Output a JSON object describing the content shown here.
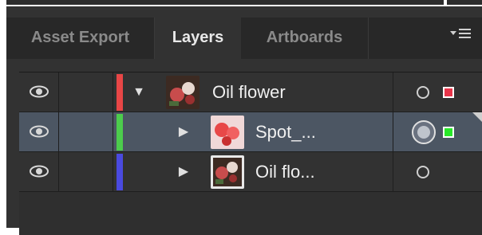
{
  "tabs": [
    {
      "label": "Asset Export",
      "active": false
    },
    {
      "label": "Layers",
      "active": true
    },
    {
      "label": "Artboards",
      "active": false
    }
  ],
  "panel_menu_icon": "hamburger-menu-icon",
  "layers": [
    {
      "name": "Oil flower",
      "color": "#e84646",
      "expanded": true,
      "selected": false,
      "square_color": "#e8354a",
      "thumb": "flowers-dark"
    },
    {
      "name": "Spot_...",
      "color": "#4ccc4c",
      "expanded": false,
      "selected": true,
      "square_color": "#29e829",
      "thumb": "flowers-red"
    },
    {
      "name": "Oil flo...",
      "color": "#4a4ae0",
      "expanded": false,
      "selected": false,
      "square_color": "",
      "thumb": "flowers-dark"
    }
  ],
  "colors": {
    "panel_bg": "#323232",
    "tabbar_bg": "#282828",
    "selected_row": "#4c5663"
  }
}
